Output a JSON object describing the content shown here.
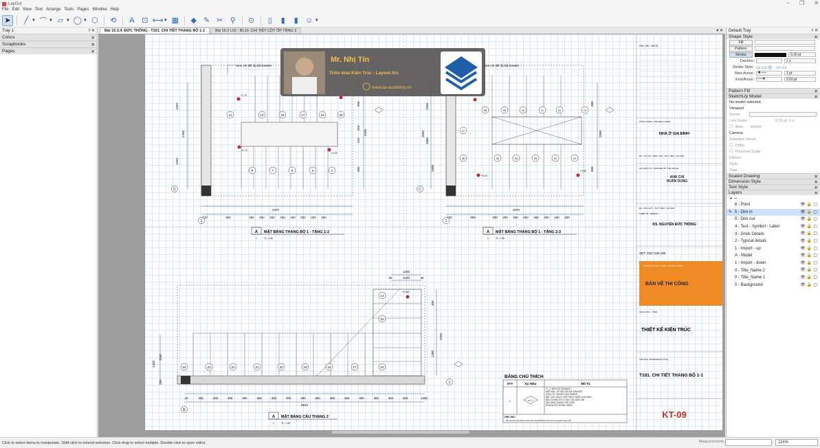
{
  "app": {
    "title": "LayOut",
    "window_controls": [
      "−",
      "❐",
      "✕"
    ]
  },
  "menu": [
    "File",
    "Edit",
    "View",
    "Text",
    "Arrange",
    "Tools",
    "Pages",
    "Window",
    "Help"
  ],
  "left_tray": {
    "title": "Tray 1",
    "panels": [
      "Colors",
      "Scrapbooks",
      "Pages"
    ]
  },
  "tabs": [
    {
      "label": "Bài 15.3.4. ĐỨC THÔNG - T101. CHI TIẾT THANG BỘ 1-1",
      "active": true
    },
    {
      "label": "Bài 15.3 L02 - BL13. CHI TIẾT CỘT ỐP TẦNG 3",
      "active": false
    }
  ],
  "tabs_controls": "▾ ✕",
  "drawing": {
    "note_left": "Xem chi tiết ốp đá Granite",
    "note_right": "Xem chi tiết ốp đá Granite",
    "plan1": {
      "code": "A",
      "title": "MẶT BẰNG THANG BỘ 1 - TẦNG 1-2",
      "scale_no": "1",
      "scale": "TL: 1:35",
      "dims_bottom": [
        "220",
        "900",
        "250",
        "250",
        "250",
        "250",
        "250",
        "250",
        "250",
        "250"
      ],
      "total": "3370",
      "dims_left": [
        "1250",
        "2450",
        "1250"
      ],
      "dims_right": [
        "950",
        "510",
        "510",
        "2590",
        "950"
      ],
      "steps_top": [
        "11",
        "13",
        "15",
        "17",
        "19",
        "20"
      ],
      "steps_bottom": [
        "9",
        "7",
        "5",
        "3",
        "1"
      ],
      "level_1": "+1.75",
      "level_2": "+0.75",
      "level_3": "±0.00",
      "level_4": "+3.60",
      "axis_c": "C",
      "axis_1": "1"
    },
    "plan2": {
      "code": "A",
      "title": "MẶT BẰNG THANG BỘ 1 - TẦNG 2-3",
      "scale_no": "1",
      "scale": "TL: 1:35",
      "dims_bottom": [
        "220",
        "900",
        "250",
        "250",
        "250",
        "250",
        "250",
        "250",
        "250",
        "250"
      ],
      "total": "3370",
      "dims_left": [
        "2650",
        "1250",
        "1050",
        "1000"
      ],
      "dims_right": [
        "950",
        "2500",
        "950"
      ],
      "steps_top": [
        "08",
        "09",
        "10",
        "11",
        "12",
        "13"
      ],
      "step_mid": "07",
      "steps_bottom": [
        "06",
        "05",
        "04",
        "03",
        "02",
        "01"
      ],
      "level_1": "+3.60",
      "level_2": "+5.20",
      "level_3": "+3.60",
      "axis_c": "C",
      "axis_1": "1"
    },
    "plan3": {
      "code": "A",
      "title": "MẶT BẰNG CẦU THANG 2",
      "scale_no": "1",
      "scale": "TL: 1:35",
      "dim_top_total": "1200",
      "dim_top_a": "1100",
      "dim_top_b": "30",
      "dim_top_c": "30",
      "dims_bottom": [
        "10",
        "300",
        "300",
        "300",
        "300",
        "300",
        "300",
        "300",
        "300",
        "300",
        "300",
        "300",
        "300",
        "300",
        "300",
        "300",
        "1200"
      ],
      "total": "5810",
      "dims_left": [
        "1430",
        "1150",
        "220"
      ],
      "dims_right": [
        "300",
        "1280",
        "2320"
      ],
      "steps_row": [
        "24",
        "23",
        "22",
        "21",
        "20",
        "19",
        "18",
        "17",
        "16"
      ],
      "steps_right": [
        "14",
        "15"
      ],
      "level": "+0.062",
      "axis_e": "E",
      "axis_1": "1"
    },
    "legend": {
      "title": "BẢNG CHÚ THÍCH",
      "col_stt": "STT",
      "col_sym": "Ký Hiệu",
      "col_desc": "Mô Tả",
      "row_stt": "1",
      "row_sym": "FL_T",
      "row_desc": "FL_T: NỀN ĐÁ GRANITE\nMẶT BẬC: ỐP BẬC ĐÁ ĐÁ GRANITE\nVỮA LÓT XM M75 TẠO PHẲNG\nBẬC XÂY GẠCH THẺ THEO CHIỀU CAO BẬC\nBẢN THANG BTCT DÀY 100, MÁC 250\nDÀY BẢN THANG TRÁT M75\nSƠN NƯỚC HOÀN THIỆN",
      "note_label": "GHI CHÚ:",
      "note": "- Tất cả các kích thước trên bản vẽ phải kiểm tra thực tế ngoài công trình"
    },
    "watermark": {
      "name": "Mr. Nhị Tín",
      "subtitle": "Triển khai Kiến Trúc - Layout Arc",
      "website": "www.ta-academy.vn"
    },
    "titleblock": {
      "notes_label": "GHI CHÚ - NOTE:",
      "project_label": "CÔNG TRÌNH - PROJECT NAME",
      "project": "NHÀ Ở GIA ĐÌNH",
      "address": "ĐC: LẠT HÀ - TRÁC VĂN - DUY TIÊN - HÀ NAM",
      "investor_label": "CHỦ ĐẦU TƯ - MASTER OF THE HOUSE",
      "investor": "ANH CHỊ\nHUẤN DUNG",
      "design_company": "ĐC: CẦU GIẤY - DUY TIÊN - HÀ NAM",
      "designer_label": "THIẾT KẾ - DESIGN",
      "designer": "KS. NGUYỄN ĐỨC THÔNG",
      "phone": "SĐT: 0327.635.468",
      "stage_label": "GIAI ĐOẠN THỰC HIỆN / DESIGN PHASE",
      "stage": "BẢN VẼ THI CÔNG",
      "item_label": "HẠNG MỤC - ITEM",
      "item": "THIẾT KẾ KIẾN TRÚC",
      "drawing_title_label": "TÊN BẢN VẼ/DRAWING TITLE",
      "drawing_title": "T101. CHI TIẾT THANG BỘ 1-1",
      "sheet": "KT-09"
    }
  },
  "right_tray": {
    "title": "Default Tray",
    "shape_style": {
      "header": "Shape Style",
      "fill": "Fill",
      "pattern": "Pattern",
      "stroke": "Stroke",
      "stroke_width": "0.20 pt",
      "dashes_label": "Dashes:",
      "dash_scale": "1 x",
      "stroke_style_label": "Stroke Style:",
      "start_arrow_label": "Start Arrow:",
      "start_arrow_size": "1 pt",
      "end_arrow_label": "End Arrow:",
      "end_arrow_size": "0.50 pt"
    },
    "pattern_fill": "Pattern Fill",
    "sketchup_model": {
      "header": "SketchUp Model",
      "no_model": "No model selected",
      "viewport": "Viewport",
      "scene": "Scene",
      "line_scale": "Line Scale",
      "line_scale_val": "0.10 pt",
      "line_scale_mult": "1 x",
      "auto": "Auto",
      "hybrid": "Hybrid",
      "camera": "Camera",
      "standard_views": "Standard Views",
      "ortho": "Ortho",
      "preserve_scale": "Preserve Scale",
      "effects": "Effects",
      "style": "Style",
      "tags": "Tags"
    },
    "scaled_drawing": "Scaled Drawing",
    "dimension_style": "Dimension Style",
    "text_style": "Text Style",
    "layers": {
      "header": "Layers",
      "add_remove": "+ −",
      "items": [
        {
          "name": "6 - Point",
          "selected": false
        },
        {
          "name": "5 - Dim in",
          "selected": true
        },
        {
          "name": "5 - Dim out",
          "selected": false
        },
        {
          "name": "4 - Text - Symbol - Label",
          "selected": false
        },
        {
          "name": "3 - Grids Details",
          "selected": false
        },
        {
          "name": "2 - Typical details",
          "selected": false
        },
        {
          "name": "1 - Import - up",
          "selected": false
        },
        {
          "name": "A - Model",
          "selected": false
        },
        {
          "name": "1 - Import - down",
          "selected": false
        },
        {
          "name": "0 - Title_Name 2",
          "selected": false
        },
        {
          "name": "0 - Title_Name 1",
          "selected": false
        },
        {
          "name": "0 - Background",
          "selected": false
        }
      ]
    }
  },
  "status": {
    "hint": "Click to select items to manipulate. Shift-click to extend selection. Click-drag to select multiple. Double-click to open editor.",
    "measurements_label": "Measurements",
    "zoom": "116%"
  },
  "colors": {
    "accent": "#2d6cc0",
    "stage_bg": "#f08a24",
    "sheet_code": "#d62a1a",
    "selection": "#cde2f8"
  }
}
